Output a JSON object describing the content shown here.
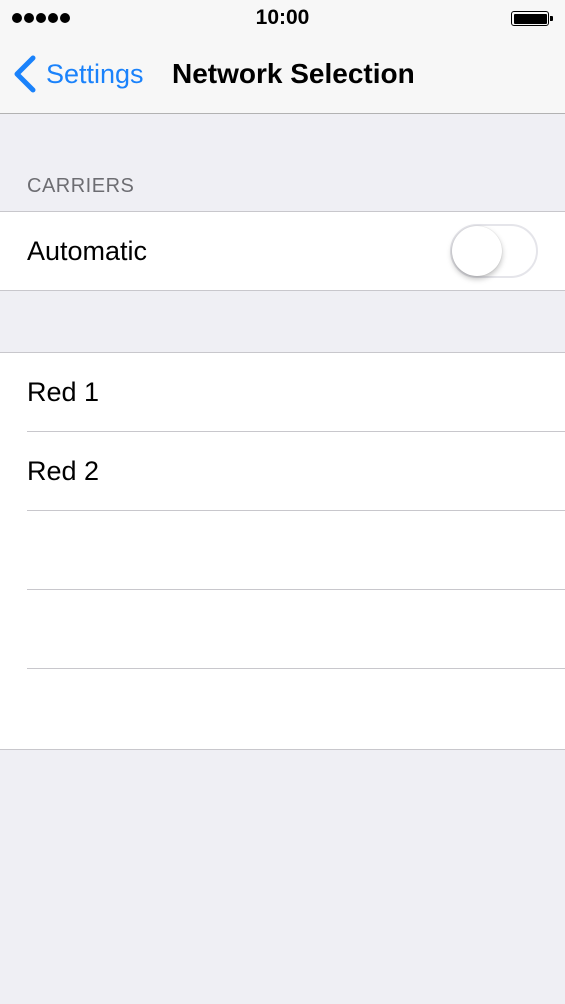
{
  "status_bar": {
    "signal_dots": 5,
    "time": "10:00",
    "battery_level": 1.0
  },
  "nav": {
    "back_label": "Settings",
    "back_icon": "chevron-left-icon",
    "title": "Network Selection"
  },
  "carriers": {
    "section_header": "CARRIERS",
    "automatic_label": "Automatic",
    "automatic_on": false
  },
  "networks": [
    {
      "label": "Red 1"
    },
    {
      "label": "Red 2"
    },
    {
      "label": ""
    },
    {
      "label": ""
    },
    {
      "label": ""
    }
  ],
  "colors": {
    "accent": "#1a82fb",
    "background": "#efeff4",
    "separator": "#c8c7cc",
    "section_header_text": "#6d6d72"
  }
}
